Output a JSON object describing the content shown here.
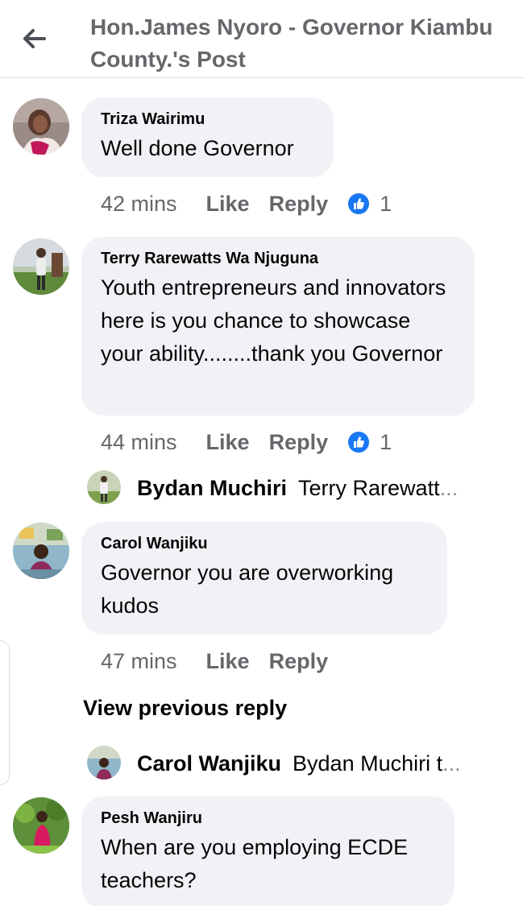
{
  "header": {
    "title": "Hon.James Nyoro - Governor Kiambu County.'s Post",
    "back_icon": "arrow-left-icon"
  },
  "colors": {
    "bubble": "#f0f2f5",
    "meta_text": "#65676b",
    "like_blue": "#1877f2"
  },
  "comments": [
    {
      "name": "Triza Wairimu",
      "text": "Well done Governor",
      "time": "42 mins",
      "like_label": "Like",
      "reply_label": "Reply",
      "reactions": "1"
    },
    {
      "name": "Terry Rarewatts Wa Njuguna",
      "text": "Youth entrepreneurs and innovators here is you chance to showcase your ability........thank you Governor",
      "time": "44 mins",
      "like_label": "Like",
      "reply_label": "Reply",
      "reactions": "1",
      "reply_preview": {
        "name": "Bydan Muchiri",
        "text": "Terry Rarewatt",
        "ellipsis": "..."
      }
    },
    {
      "name": "Carol Wanjiku",
      "text": "Governor you are overworking kudos",
      "time": "47 mins",
      "like_label": "Like",
      "reply_label": "Reply",
      "view_previous": "View previous reply",
      "reply_preview": {
        "name": "Carol Wanjiku",
        "text": "Bydan Muchiri t",
        "ellipsis": "..."
      }
    },
    {
      "name": "Pesh Wanjiru",
      "text": "When are you employing ECDE teachers?"
    }
  ]
}
